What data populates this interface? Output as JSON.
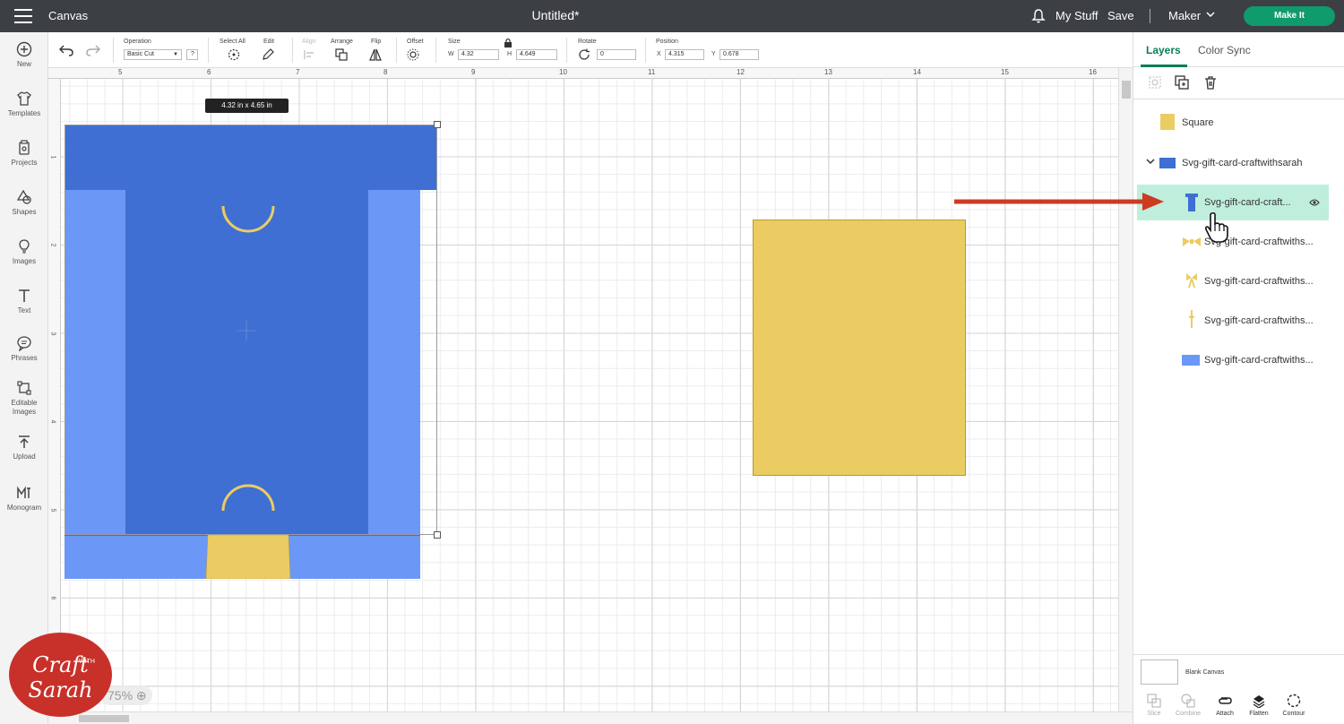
{
  "topbar": {
    "app_title": "Canvas",
    "doc_title": "Untitled*",
    "my_stuff": "My Stuff",
    "save": "Save",
    "machine": "Maker",
    "make_it": "Make It"
  },
  "leftbar": {
    "items": [
      {
        "label": "New",
        "icon": "plus-circle-icon"
      },
      {
        "label": "Templates",
        "icon": "shirt-icon"
      },
      {
        "label": "Projects",
        "icon": "projects-icon"
      },
      {
        "label": "Shapes",
        "icon": "shapes-icon"
      },
      {
        "label": "Images",
        "icon": "lightbulb-icon"
      },
      {
        "label": "Text",
        "icon": "text-icon"
      },
      {
        "label": "Phrases",
        "icon": "speech-bubble-icon"
      },
      {
        "label": "Editable Images",
        "icon": "editable-images-icon"
      },
      {
        "label": "Upload",
        "icon": "upload-icon"
      },
      {
        "label": "Monogram",
        "icon": "monogram-icon"
      }
    ]
  },
  "toolbar": {
    "operation_label": "Operation",
    "operation_value": "Basic Cut",
    "help": "?",
    "select_all": "Select All",
    "edit": "Edit",
    "align": "Align",
    "arrange": "Arrange",
    "flip": "Flip",
    "offset": "Offset",
    "size_label": "Size",
    "w_label": "W",
    "w_value": "4.32",
    "h_label": "H",
    "h_value": "4.649",
    "rotate_label": "Rotate",
    "rotate_value": "0",
    "position_label": "Position",
    "x_label": "X",
    "x_value": "4.315",
    "y_label": "Y",
    "y_value": "0.678"
  },
  "ruler": {
    "top_ticks": [
      "5",
      "6",
      "7",
      "8",
      "9",
      "10",
      "11",
      "12",
      "13",
      "14",
      "15",
      "16"
    ],
    "left_ticks": [
      "1",
      "2",
      "3",
      "4",
      "5",
      "6"
    ]
  },
  "canvas": {
    "size_tooltip": "4.32  in x 4.65  in",
    "zoom": "75%",
    "colors": {
      "dark_blue": "#3f6fd3",
      "light_blue": "#6b97f7",
      "yellow": "#ebcc62"
    }
  },
  "watermark": {
    "line1": "Craft",
    "line2": "Sarah",
    "small": "WITH"
  },
  "right_panel": {
    "tabs": [
      "Layers",
      "Color Sync"
    ],
    "layers": [
      {
        "label": "Square",
        "indent": 0
      },
      {
        "label": "Svg-gift-card-craftwithsarah",
        "indent": 0,
        "group": true
      },
      {
        "label": "Svg-gift-card-craft...",
        "indent": 1,
        "selected": true
      },
      {
        "label": "Svg-gift-card-craftwiths...",
        "indent": 1
      },
      {
        "label": "Svg-gift-card-craftwiths...",
        "indent": 1
      },
      {
        "label": "Svg-gift-card-craftwiths...",
        "indent": 1
      },
      {
        "label": "Svg-gift-card-craftwiths...",
        "indent": 1
      }
    ],
    "blank_canvas": "Blank Canvas",
    "actions": [
      {
        "label": "Slice",
        "enabled": false
      },
      {
        "label": "Combine",
        "enabled": false
      },
      {
        "label": "Attach",
        "enabled": true
      },
      {
        "label": "Flatten",
        "enabled": true
      },
      {
        "label": "Contour",
        "enabled": true
      }
    ]
  }
}
